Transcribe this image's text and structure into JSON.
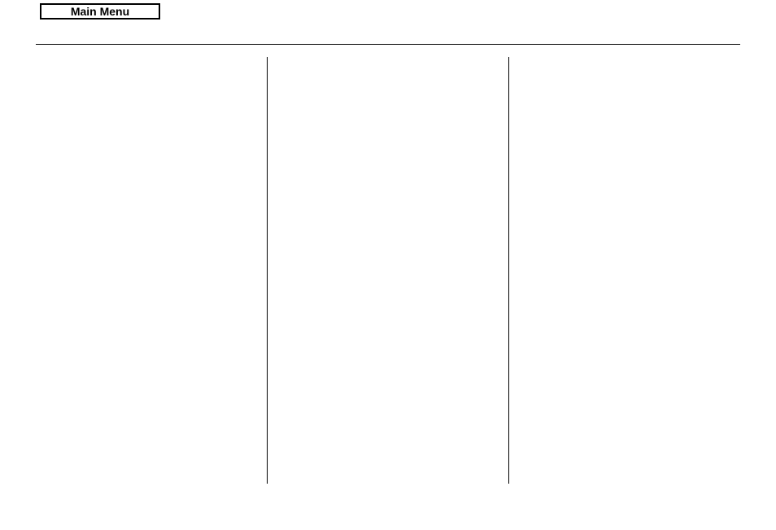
{
  "header": {
    "mainMenuLabel": "Main Menu"
  }
}
